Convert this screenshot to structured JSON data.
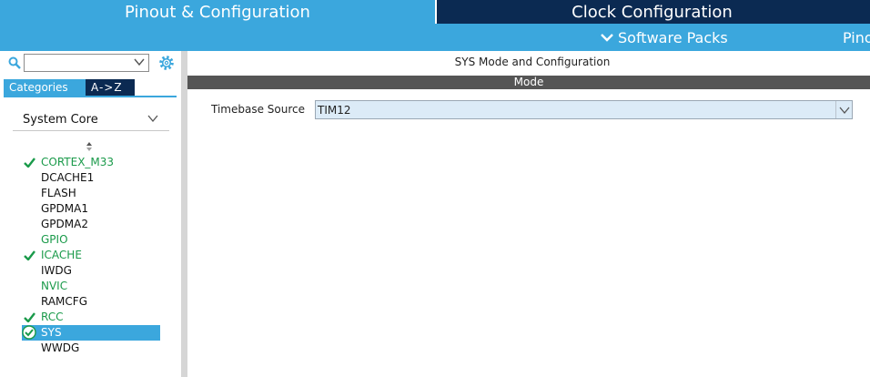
{
  "tabs": {
    "pinout": "Pinout & Configuration",
    "clock": "Clock Configuration"
  },
  "submenu": {
    "software_packs": "Software Packs",
    "pinout": "Pinout"
  },
  "left": {
    "search": {
      "value": "",
      "placeholder": ""
    },
    "category_tabs": [
      "Categories",
      "A->Z"
    ],
    "group": "System Core",
    "items": [
      {
        "label": "CORTEX_M33",
        "state": "checked"
      },
      {
        "label": "DCACHE1",
        "state": "normal"
      },
      {
        "label": "FLASH",
        "state": "normal"
      },
      {
        "label": "GPDMA1",
        "state": "normal"
      },
      {
        "label": "GPDMA2",
        "state": "normal"
      },
      {
        "label": "GPIO",
        "state": "green"
      },
      {
        "label": "ICACHE",
        "state": "checked"
      },
      {
        "label": "IWDG",
        "state": "normal"
      },
      {
        "label": "NVIC",
        "state": "green"
      },
      {
        "label": "RAMCFG",
        "state": "normal"
      },
      {
        "label": "RCC",
        "state": "checked"
      },
      {
        "label": "SYS",
        "state": "selected"
      },
      {
        "label": "WWDG",
        "state": "normal"
      }
    ]
  },
  "right": {
    "title": "SYS Mode and Configuration",
    "mode_header": "Mode",
    "timebase_label": "Timebase Source",
    "timebase_value": "TIM12"
  },
  "colors": {
    "accent": "#3ba7dd",
    "dark_tab": "#0b2a52",
    "ok_green": "#1a9a4a",
    "mode_bar": "#555555"
  }
}
